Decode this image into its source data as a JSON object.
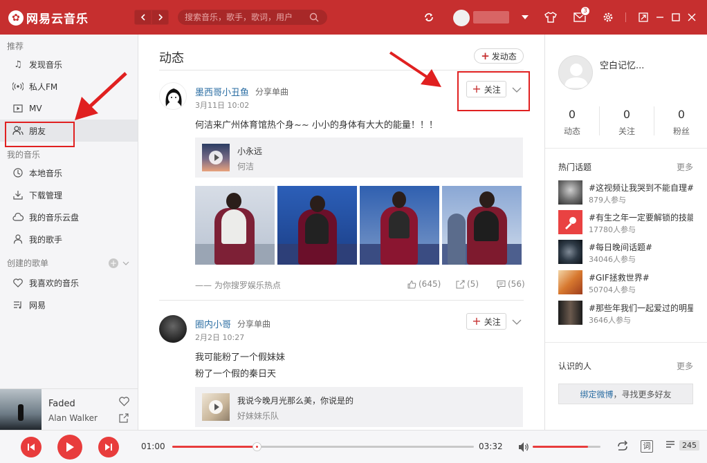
{
  "app": {
    "logo_text": "网易云音乐",
    "search_placeholder": "搜索音乐，歌手，歌词，用户",
    "messages_badge": "3"
  },
  "sidebar": {
    "section_recommend": "推荐",
    "recommend_items": [
      {
        "label": "发现音乐",
        "icon": "music-note-icon"
      },
      {
        "label": "私人FM",
        "icon": "radio-icon"
      },
      {
        "label": "MV",
        "icon": "video-icon"
      },
      {
        "label": "朋友",
        "icon": "friends-icon",
        "active": true
      }
    ],
    "section_my_music": "我的音乐",
    "my_music_items": [
      {
        "label": "本地音乐",
        "icon": "local-music-icon"
      },
      {
        "label": "下载管理",
        "icon": "download-icon"
      },
      {
        "label": "我的音乐云盘",
        "icon": "cloud-icon"
      },
      {
        "label": "我的歌手",
        "icon": "singer-icon"
      }
    ],
    "section_created": "创建的歌单",
    "playlists": [
      {
        "label": "我喜欢的音乐",
        "icon": "heart-icon"
      },
      {
        "label": "网易",
        "icon": "playlist-icon"
      }
    ]
  },
  "now_playing": {
    "title": "Faded",
    "artist": "Alan Walker"
  },
  "main": {
    "title": "动态",
    "post_button": "发动态",
    "posts": [
      {
        "user": "墨西哥小丑鱼",
        "action": "分享单曲",
        "time": "3月11日 10:02",
        "follow_label": "关注",
        "text": "何洁来广州体育馆热个身~~ 小小的身体有大大的能量！！！",
        "song_title": "小永远",
        "song_artist": "何洁",
        "source": "—— 为你搜罗娱乐热点",
        "likes": "(645)",
        "shares": "(5)",
        "comments": "(56)"
      },
      {
        "user": "圈内小哥",
        "action": "分享单曲",
        "time": "2月2日 10:27",
        "follow_label": "关注",
        "text_line1": "我可能粉了一个假妹妹",
        "text_line2": "粉了一个假的秦日天",
        "song_title": "我说今晚月光那么美，你说是的",
        "song_artist": "好妹妹乐队"
      }
    ]
  },
  "right_panel": {
    "username": "空白记忆...",
    "stats": [
      {
        "value": "0",
        "label": "动态"
      },
      {
        "value": "0",
        "label": "关注"
      },
      {
        "value": "0",
        "label": "粉丝"
      }
    ],
    "hot_topics_title": "热门话题",
    "more_label": "更多",
    "topics": [
      {
        "title": "#这视频让我哭到不能自理#",
        "count": "879人参与"
      },
      {
        "title": "#有生之年一定要解锁的技能#",
        "count": "17780人参与"
      },
      {
        "title": "#每日晚间话题#",
        "count": "34046人参与"
      },
      {
        "title": "#GIF拯救世界#",
        "count": "50704人参与"
      },
      {
        "title": "#那些年我们一起爱过的明星#",
        "count": "3646人参与"
      }
    ],
    "people_title": "认识的人",
    "people_more": "更多",
    "weibo_link": "绑定微博",
    "weibo_rest": "，寻找更多好友"
  },
  "player": {
    "current_time": "01:00",
    "total_time": "03:32",
    "progress": 0.28,
    "volume": 0.82,
    "lyric_label": "词",
    "playlist_count": "245"
  },
  "colors": {
    "brand": "#c62f2f",
    "accent": "#e83c3c",
    "link": "#2b6ea3"
  }
}
